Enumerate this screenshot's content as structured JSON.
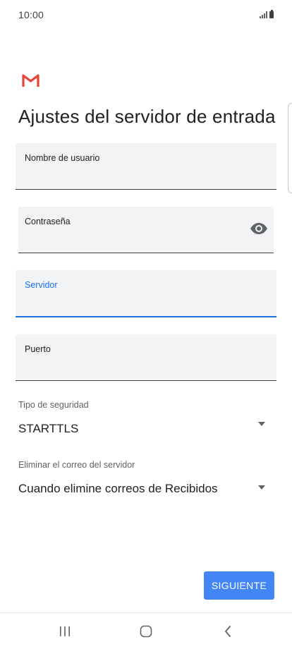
{
  "status_bar": {
    "time": "10:00"
  },
  "header": {
    "logo_icon": "gmail-icon",
    "title": "Ajustes del servidor de entrada"
  },
  "form": {
    "username": {
      "label": "Nombre de usuario",
      "value": ""
    },
    "password": {
      "label": "Contraseña",
      "value": "",
      "toggle_icon": "visibility-icon"
    },
    "server": {
      "label": "Servidor",
      "value": "",
      "focused": true
    },
    "port": {
      "label": "Puerto",
      "value": ""
    },
    "security_type": {
      "caption": "Tipo de seguridad",
      "value": "STARTTLS"
    },
    "delete_policy": {
      "caption": "Eliminar el correo del servidor",
      "value": "Cuando elimine correos de Recibidos"
    }
  },
  "actions": {
    "next_label": "SIGUIENTE"
  },
  "nav": {
    "recents_icon": "recents-icon",
    "home_icon": "home-icon",
    "back_icon": "back-icon"
  },
  "colors": {
    "accent": "#1a73e8",
    "button": "#4285f4",
    "field_bg": "#f1f3f4",
    "gmail_red": "#ea4335"
  }
}
